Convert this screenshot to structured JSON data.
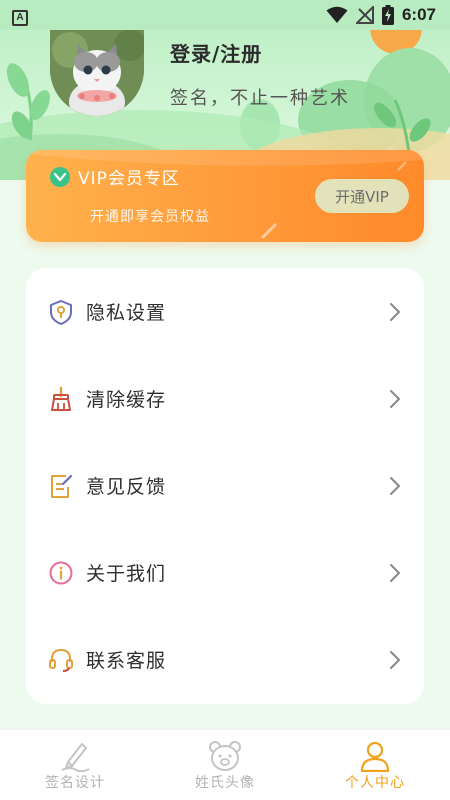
{
  "status_bar": {
    "time": "6:07",
    "left_badge": "A"
  },
  "profile": {
    "username": "登录/注册",
    "signature": "签名，不止一种艺术"
  },
  "vip": {
    "title": "VIP会员专区",
    "subtitle": "开通即享会员权益",
    "button_label": "开通VIP"
  },
  "menu": {
    "items": [
      {
        "label": "隐私设置",
        "icon": "shield-lock-icon"
      },
      {
        "label": "清除缓存",
        "icon": "broom-icon"
      },
      {
        "label": "意见反馈",
        "icon": "feedback-edit-icon"
      },
      {
        "label": "关于我们",
        "icon": "info-circle-icon"
      },
      {
        "label": "联系客服",
        "icon": "headset-icon"
      }
    ]
  },
  "bottom_nav": {
    "tabs": [
      {
        "label": "签名设计",
        "icon": "pen-signature-icon",
        "active": false
      },
      {
        "label": "姓氏头像",
        "icon": "bear-face-icon",
        "active": false
      },
      {
        "label": "个人中心",
        "icon": "person-icon",
        "active": true
      }
    ]
  },
  "colors": {
    "accent": "#f0a21e",
    "vip_gradient_start": "#ffb24d",
    "vip_gradient_end": "#ff8a2a",
    "header_green": "#bff0c7"
  }
}
